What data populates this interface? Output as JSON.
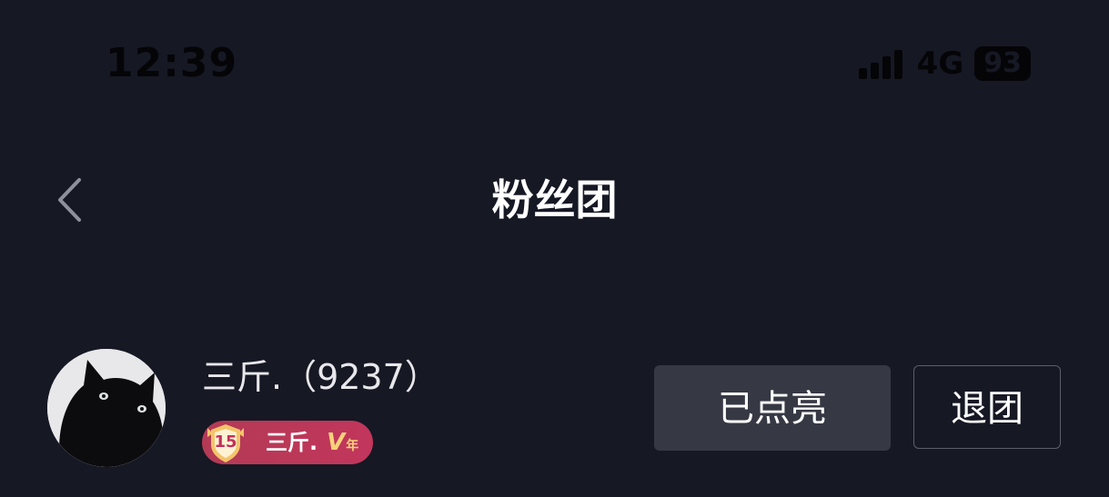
{
  "status_bar": {
    "time": "12:39",
    "network": "4G",
    "battery": "93"
  },
  "nav": {
    "back_icon": "chevron-left-icon",
    "title": "粉丝团"
  },
  "member": {
    "avatar_icon": "black-cat-avatar",
    "name": "三斤.（9237）",
    "badge": {
      "level": "15",
      "name": "三斤.",
      "tag_v": "V",
      "tag_year": "年",
      "color": "#c2365c"
    }
  },
  "actions": {
    "lit_label": "已点亮",
    "quit_label": "退团"
  }
}
